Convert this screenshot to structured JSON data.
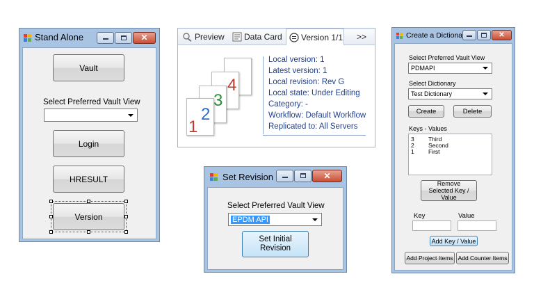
{
  "stand_alone": {
    "title": "Stand Alone",
    "vault_button": "Vault",
    "vault_view_label": "Select Preferred Vault View",
    "vault_view_value": "",
    "login_button": "Login",
    "hresult_button": "HRESULT",
    "version_button": "Version"
  },
  "version_card": {
    "tabs": [
      {
        "label": "Preview",
        "icon": "preview-icon"
      },
      {
        "label": "Data Card",
        "icon": "data-card-icon"
      },
      {
        "label": "Version 1/1",
        "icon": "version-icon"
      },
      {
        "label": ">>",
        "icon": ""
      }
    ],
    "digits": [
      "1",
      "2",
      "3",
      "4"
    ],
    "digit_colors": [
      "#c0392b",
      "#2e6fc2",
      "#2e8b3c",
      "#c0392b"
    ],
    "lines": [
      "Local version: 1",
      "Latest version: 1",
      "Local revision: Rev G",
      "Local state: Under Editing",
      "Category: -",
      "Workflow: Default Workflow",
      "Replicated to: All Servers"
    ]
  },
  "set_revision": {
    "title": "Set Revision",
    "vault_view_label": "Select Preferred Vault View",
    "vault_view_value": "EPDM API",
    "set_initial_button": "Set Initial Revision"
  },
  "dictionary": {
    "title": "Create a Dictionary",
    "vault_view_label": "Select Preferred Vault View",
    "vault_view_value": "PDMAPI",
    "dictionary_label": "Select Dictionary",
    "dictionary_value": "Test Dictionary",
    "create_button": "Create",
    "delete_button": "Delete",
    "keys_values_label": "Keys - Values",
    "list_items": [
      {
        "key": "3",
        "value": "Third"
      },
      {
        "key": "2",
        "value": "Second"
      },
      {
        "key": "1",
        "value": "First"
      }
    ],
    "remove_button": "Remove Selected Key / Value",
    "key_label": "Key",
    "value_label": "Value",
    "key_input": "",
    "value_input": "",
    "add_kv_button": "Add Key / Value",
    "add_project_button": "Add Project Items",
    "add_counter_button": "Add Counter Items"
  },
  "colors": {
    "title_bar": "#a9c3e2",
    "close_button": "#c84f35",
    "card_text": "#1f3f8f",
    "selection": "#3399ff"
  }
}
